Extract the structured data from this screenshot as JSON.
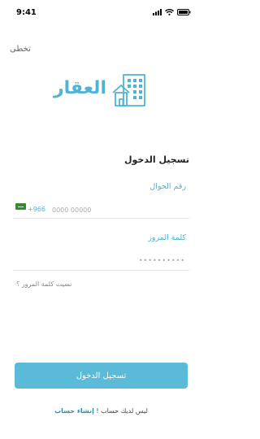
{
  "status_bar": {
    "time": "9:41"
  },
  "header": {
    "skip_label": "تخطى"
  },
  "logo": {
    "text": "العقار",
    "icon": "building-icon",
    "color": "#4fb3d5"
  },
  "login": {
    "title": "تسجيل الدخول",
    "phone_label": "رقم الجوال",
    "country_code": "+966",
    "phone_placeholder": "0000 00000",
    "password_label": "كلمة المرور",
    "password_placeholder": "••••••••••",
    "forgot_password": "نسيت كلمة المرور ؟",
    "submit_label": "تسجيل الدخول"
  },
  "footer": {
    "no_account_text": "ليس لديك حساب !",
    "create_account_link": "إنشاء حساب"
  },
  "colors": {
    "accent": "#5bbad8",
    "link": "#2b8cb8",
    "flag": "#2f8f2f"
  }
}
